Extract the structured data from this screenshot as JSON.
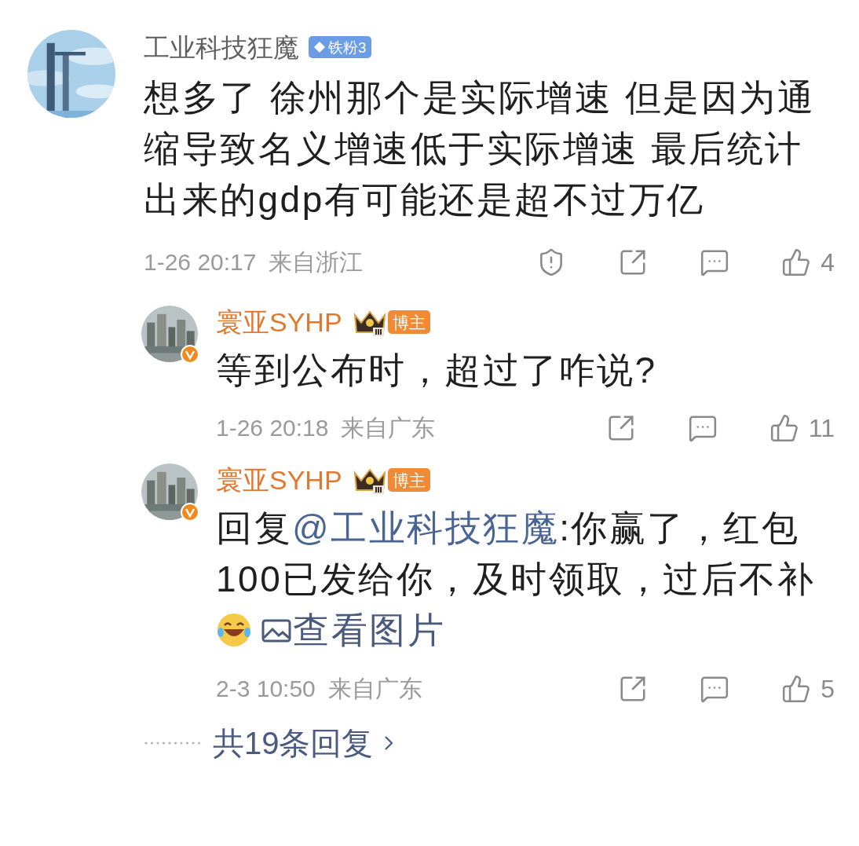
{
  "comment": {
    "author": "工业科技狂魔",
    "badge": {
      "kind": "fan",
      "text": "铁粉3"
    },
    "text": "想多了 徐州那个是实际增速 但是因为通缩导致名义增速低于实际增速 最后统计出来的gdp有可能还是超不过万亿",
    "time": "1-26 20:17",
    "location": "来自浙江",
    "actions": [
      {
        "kind": "report"
      },
      {
        "kind": "share"
      },
      {
        "kind": "comment"
      },
      {
        "kind": "like",
        "count": "4"
      }
    ],
    "replies": [
      {
        "author": "寰亚SYHP",
        "badge": {
          "kind": "blogger",
          "text": "博主"
        },
        "verified": true,
        "segments": [
          {
            "kind": "text",
            "text": "等到公布时，超过了咋说?"
          }
        ],
        "time": "1-26 20:18",
        "location": "来自广东",
        "actions": [
          {
            "kind": "share"
          },
          {
            "kind": "comment"
          },
          {
            "kind": "like",
            "count": "11"
          }
        ]
      },
      {
        "author": "寰亚SYHP",
        "badge": {
          "kind": "blogger",
          "text": "博主"
        },
        "verified": true,
        "segments": [
          {
            "kind": "text",
            "text": "回复"
          },
          {
            "kind": "mention",
            "text": "@工业科技狂魔"
          },
          {
            "kind": "text",
            "text": ":你赢了，红包100已发给你，及时领取，过后不补"
          },
          {
            "kind": "emoji"
          },
          {
            "kind": "image_link",
            "text": "查看图片"
          }
        ],
        "time": "2-3 10:50",
        "location": "来自广东",
        "actions": [
          {
            "kind": "share"
          },
          {
            "kind": "comment"
          },
          {
            "kind": "like",
            "count": "5"
          }
        ]
      }
    ],
    "more_replies": {
      "text": "共19条回复"
    }
  }
}
